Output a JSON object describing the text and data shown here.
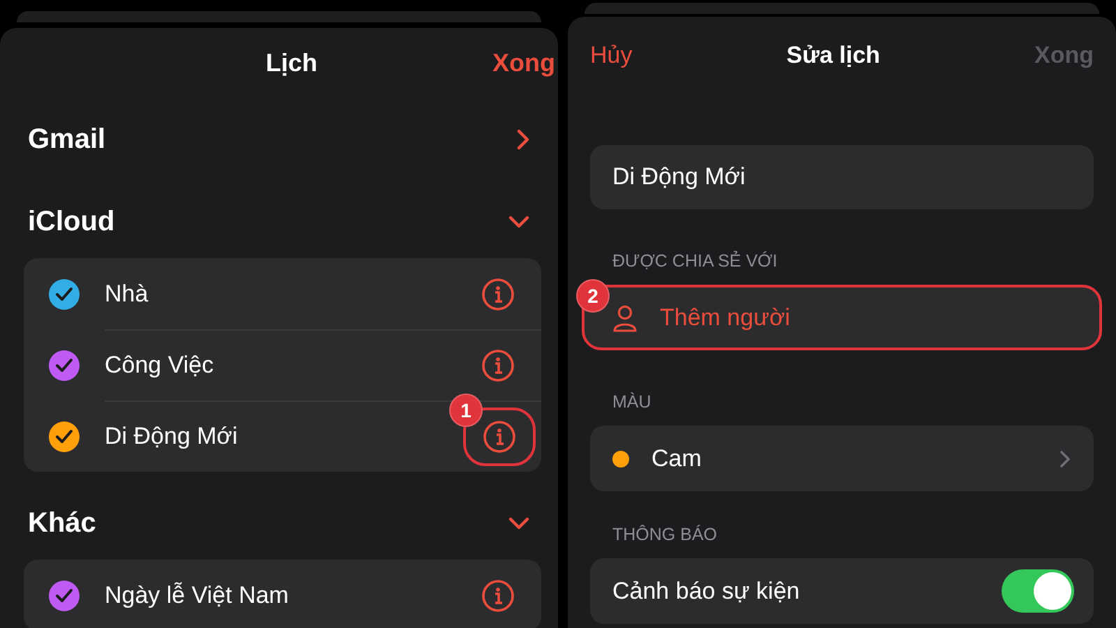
{
  "left_panel": {
    "title": "Lịch",
    "done_button": "Xong",
    "sections": [
      {
        "name": "Gmail",
        "expanded": false
      },
      {
        "name": "iCloud",
        "expanded": true,
        "calendars": [
          {
            "name": "Nhà",
            "color": "#32ade6",
            "checked": true
          },
          {
            "name": "Công Việc",
            "color": "#bf5af2",
            "checked": true
          },
          {
            "name": "Di Động Mới",
            "color": "#ff9f0a",
            "checked": true,
            "annotation": "1"
          }
        ]
      },
      {
        "name": "Khác",
        "expanded": true,
        "calendars": [
          {
            "name": "Ngày lễ Việt Nam",
            "color": "#bf5af2",
            "checked": true
          }
        ]
      }
    ]
  },
  "right_panel": {
    "cancel_button": "Hủy",
    "title": "Sửa lịch",
    "done_button": {
      "label": "Xong",
      "disabled": true
    },
    "name_field": {
      "value": "Di Động Mới"
    },
    "shared_section": {
      "header": "ĐƯỢC CHIA SẺ VỚI",
      "add_person": {
        "label": "Thêm người",
        "annotation": "2"
      }
    },
    "color_section": {
      "header": "MÀU",
      "selected_color": {
        "label": "Cam",
        "color": "#ff9f0a"
      }
    },
    "notification_section": {
      "header": "THÔNG BÁO",
      "event_alert": {
        "label": "Cảnh báo sự kiện",
        "on": true
      }
    }
  }
}
